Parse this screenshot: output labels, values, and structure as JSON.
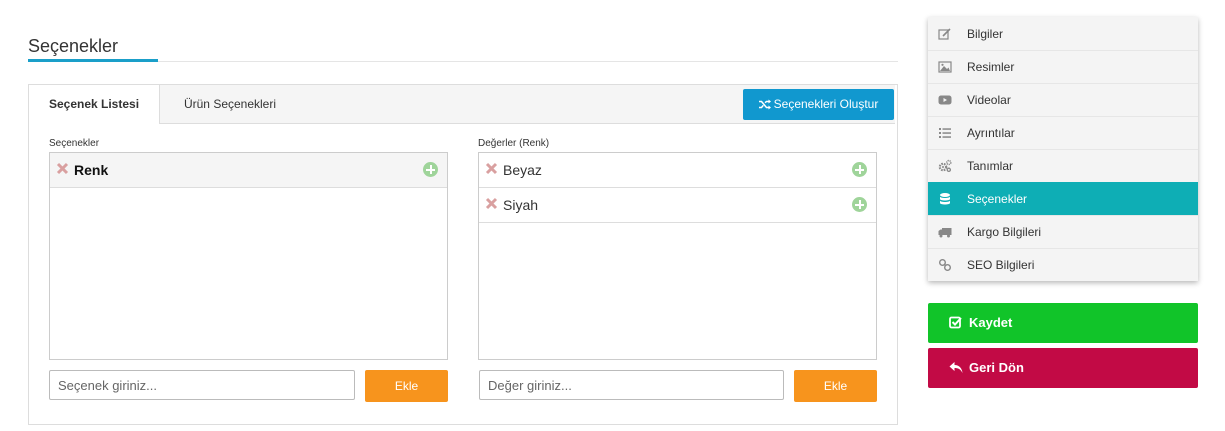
{
  "page": {
    "title": "Seçenekler"
  },
  "tabs": {
    "active": "Seçenek Listesi",
    "inactive": "Ürün Seçenekleri"
  },
  "generate_button": {
    "label": "Seçenekleri Oluştur",
    "icon": "shuffle-icon"
  },
  "options": {
    "label": "Seçenekler",
    "items": [
      "Renk"
    ],
    "input_placeholder": "Seçenek giriniz...",
    "add_label": "Ekle"
  },
  "values": {
    "label": "Değerler (Renk)",
    "items": [
      "Beyaz",
      "Siyah"
    ],
    "input_placeholder": "Değer giriniz...",
    "add_label": "Ekle"
  },
  "sidebar": {
    "items": [
      {
        "label": "Bilgiler",
        "icon": "edit-icon"
      },
      {
        "label": "Resimler",
        "icon": "image-icon"
      },
      {
        "label": "Videolar",
        "icon": "video-icon"
      },
      {
        "label": "Ayrıntılar",
        "icon": "list-icon"
      },
      {
        "label": "Tanımlar",
        "icon": "cogs-icon"
      },
      {
        "label": "Seçenekler",
        "icon": "database-icon"
      },
      {
        "label": "Kargo Bilgileri",
        "icon": "truck-icon"
      },
      {
        "label": "SEO Bilgileri",
        "icon": "link-icon"
      }
    ],
    "active_index": 5
  },
  "actions": {
    "save_label": "Kaydet",
    "back_label": "Geri Dön"
  },
  "colors": {
    "accent": "#1a9fc9",
    "generate": "#1198cf",
    "add": "#f7941d",
    "active_sidebar": "#0eaeb5",
    "save": "#11c429",
    "back": "#c20a45"
  }
}
